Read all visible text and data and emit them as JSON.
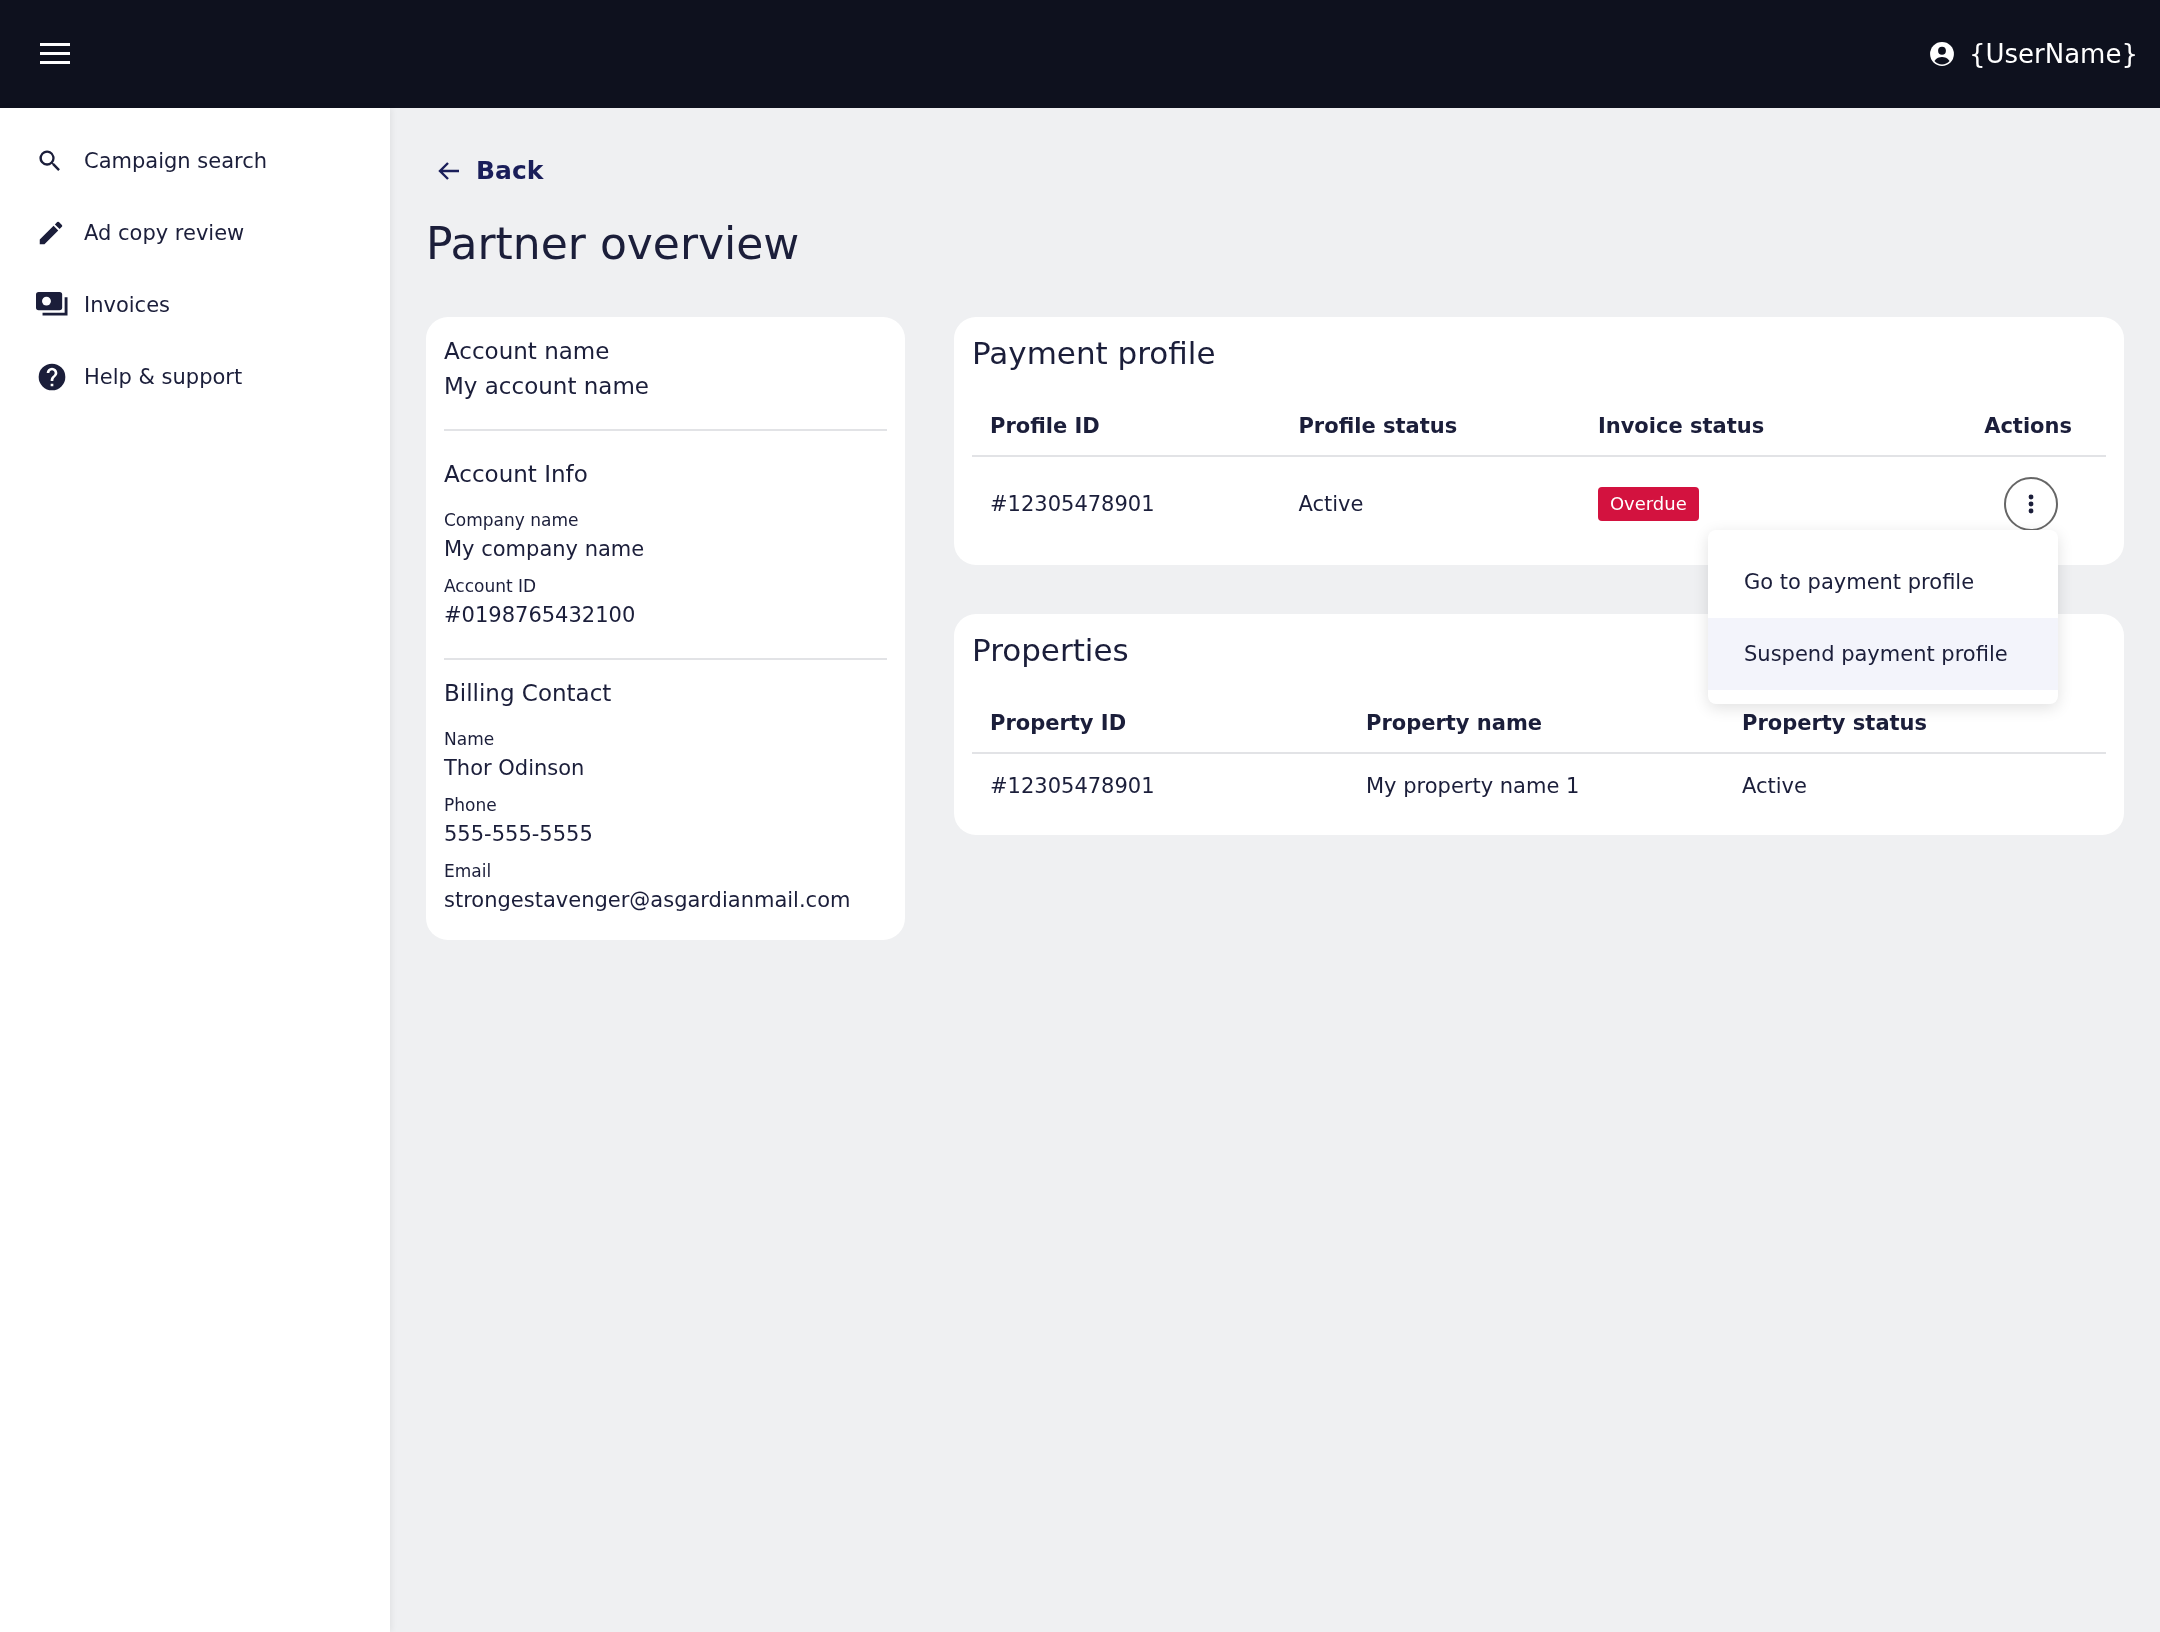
{
  "top_bar": {
    "user_name": "{UserName}"
  },
  "sidebar": {
    "items": [
      {
        "kind": "search",
        "label": "Campaign search"
      },
      {
        "kind": "pencil",
        "label": "Ad copy review"
      },
      {
        "kind": "money",
        "label": "Invoices"
      },
      {
        "kind": "help",
        "label": "Help & support"
      }
    ]
  },
  "back_link": "Back",
  "page_title": "Partner overview",
  "account_card": {
    "account_name_label": "Account name",
    "account_name": "My account name",
    "sections": [
      {
        "title": "Account Info",
        "fields": [
          {
            "label": "Company name",
            "value": "My company name"
          },
          {
            "label": "Account ID",
            "value": "#0198765432100"
          }
        ]
      },
      {
        "title": "Billing Contact",
        "fields": [
          {
            "label": "Name",
            "value": "Thor Odinson"
          },
          {
            "label": "Phone",
            "value": "555-555-5555"
          },
          {
            "label": "Email",
            "value": "strongestavenger@asgardianmail.com"
          }
        ]
      }
    ]
  },
  "payment_profile": {
    "title": "Payment profile",
    "columns": [
      "Profile ID",
      "Profile status",
      "Invoice status",
      "Actions"
    ],
    "rows": [
      {
        "profile_id": "#12305478901",
        "profile_status": "Active",
        "invoice_status": "Overdue"
      }
    ],
    "actions_menu": [
      {
        "label": "Go to payment profile",
        "selected": false
      },
      {
        "label": "Suspend payment profile",
        "selected": true
      }
    ]
  },
  "properties": {
    "title": "Properties",
    "columns": [
      "Property ID",
      "Property name",
      "Property status"
    ],
    "rows": [
      {
        "property_id": "#12305478901",
        "property_name": "My property name 1",
        "property_status": "Active"
      }
    ]
  }
}
